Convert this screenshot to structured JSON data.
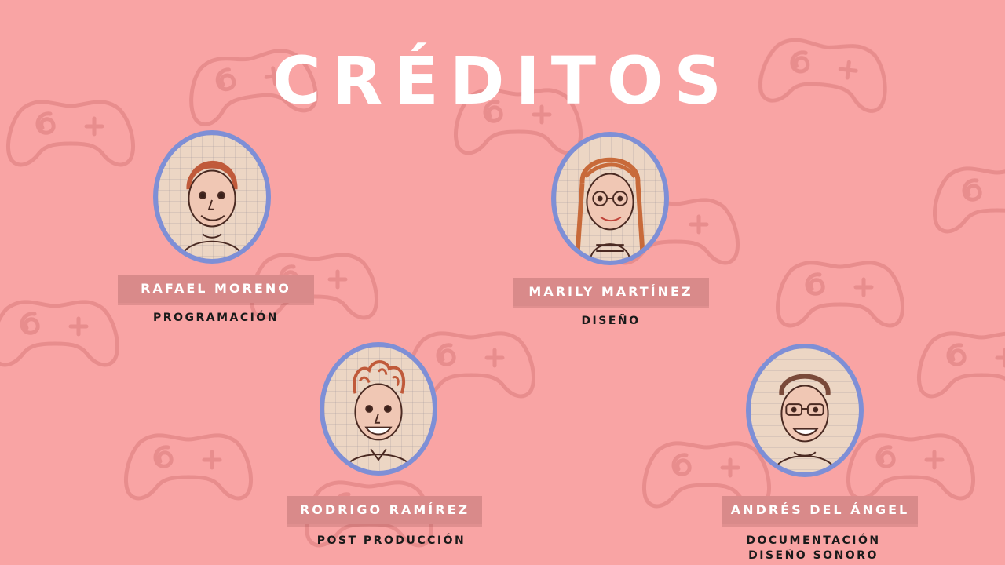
{
  "title": "CRÉDITOS",
  "colors": {
    "background": "#f9a4a4",
    "pattern_stroke": "#e58a8a",
    "portrait_frame": "#7e8fd6",
    "banner": "#d98a8a",
    "title_text": "#ffffff",
    "role_text": "#1a1a1a"
  },
  "background_icon": "gamepad-icon",
  "credits": [
    {
      "name": "RAFAEL MORENO",
      "roles": [
        "PROGRAMACIÓN"
      ],
      "portrait_icon": "portrait-sketch-rafael"
    },
    {
      "name": "MARILY MARTÍNEZ",
      "roles": [
        "DISEÑO"
      ],
      "portrait_icon": "portrait-sketch-marily"
    },
    {
      "name": "RODRIGO RAMÍREZ",
      "roles": [
        "POST PRODUCCIÓN"
      ],
      "portrait_icon": "portrait-sketch-rodrigo"
    },
    {
      "name": "ANDRÉS DEL ÁNGEL",
      "roles": [
        "DOCUMENTACIÓN",
        "DISEÑO SONORO"
      ],
      "portrait_icon": "portrait-sketch-andres"
    }
  ]
}
